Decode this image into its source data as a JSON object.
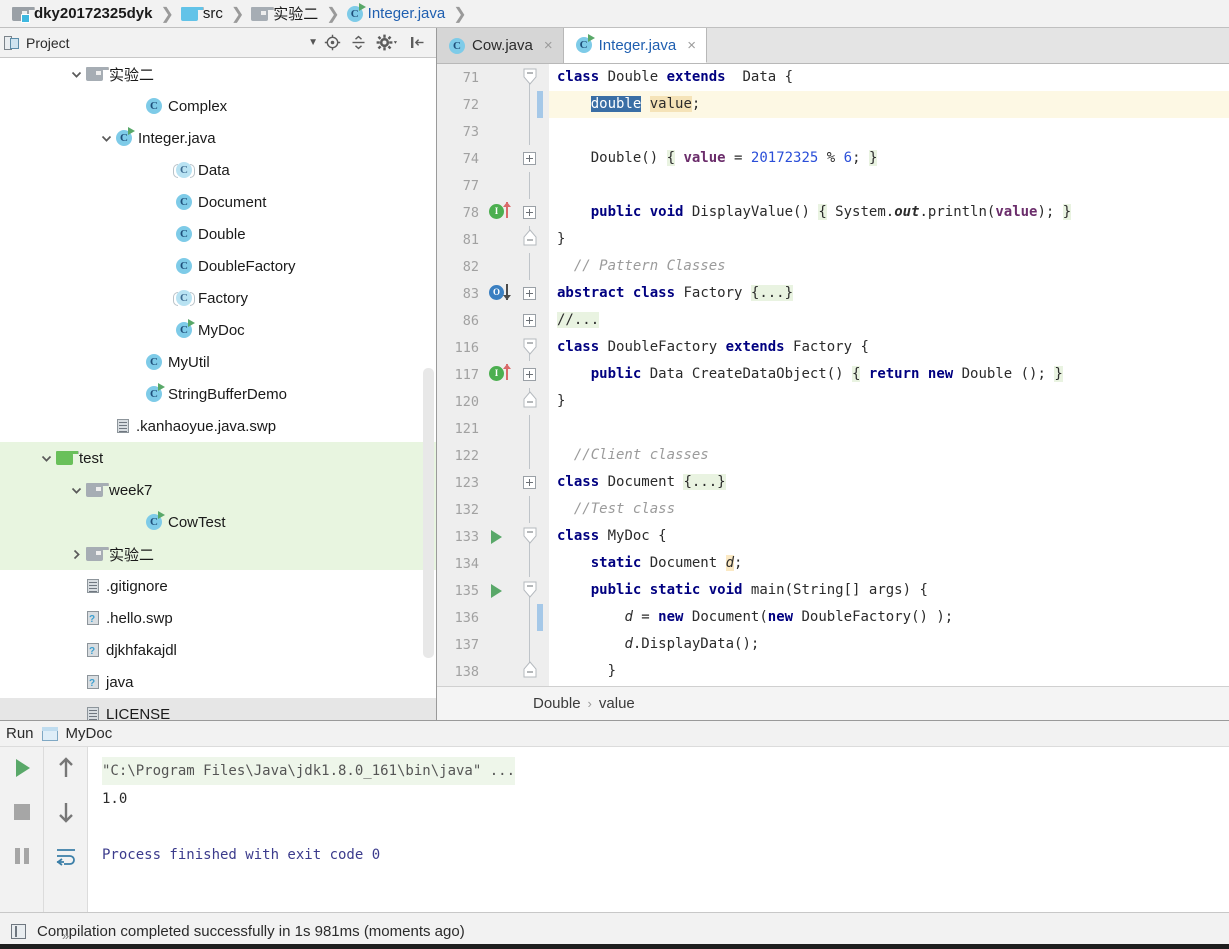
{
  "breadcrumb": [
    {
      "label": "dky20172325dyk",
      "icon": "folder-module-icon",
      "bold": true
    },
    {
      "label": "src",
      "icon": "folder-blue-icon",
      "bold": false
    },
    {
      "label": "实验二",
      "icon": "folder-gray-icon",
      "bold": false
    },
    {
      "label": "Integer.java",
      "icon": "java-class-run-icon",
      "bold": false,
      "active": true
    }
  ],
  "project_panel": {
    "title": "Project",
    "icons": {
      "project": "project-icon",
      "caret": "chevron-down-icon",
      "locate": "locate-target-icon",
      "collapse": "collapse-all-icon",
      "settings": "gear-icon",
      "hide": "hide-panel-icon"
    },
    "tree": [
      {
        "label": "实验二",
        "icon": "folder-gray-icon",
        "indent": 2,
        "twisty": "down",
        "state": "normal"
      },
      {
        "label": "Complex",
        "icon": "java-class-icon",
        "indent": 4,
        "twisty": "none",
        "state": "normal"
      },
      {
        "label": "Integer.java",
        "icon": "java-class-run-icon",
        "indent": 3,
        "twisty": "down",
        "state": "normal"
      },
      {
        "label": "Data",
        "icon": "java-abstract-class-icon",
        "indent": 5,
        "twisty": "none",
        "state": "normal"
      },
      {
        "label": "Document",
        "icon": "java-class-icon",
        "indent": 5,
        "twisty": "none",
        "state": "normal"
      },
      {
        "label": "Double",
        "icon": "java-class-icon",
        "indent": 5,
        "twisty": "none",
        "state": "normal"
      },
      {
        "label": "DoubleFactory",
        "icon": "java-class-icon",
        "indent": 5,
        "twisty": "none",
        "state": "normal"
      },
      {
        "label": "Factory",
        "icon": "java-abstract-class-icon",
        "indent": 5,
        "twisty": "none",
        "state": "normal"
      },
      {
        "label": "MyDoc",
        "icon": "java-class-run-icon",
        "indent": 5,
        "twisty": "none",
        "state": "normal"
      },
      {
        "label": "MyUtil",
        "icon": "java-class-icon",
        "indent": 4,
        "twisty": "none",
        "state": "normal"
      },
      {
        "label": "StringBufferDemo",
        "icon": "java-class-run-icon",
        "indent": 4,
        "twisty": "none",
        "state": "normal"
      },
      {
        "label": ".kanhaoyue.java.swp",
        "icon": "file-icon",
        "indent": 3,
        "twisty": "none",
        "state": "normal"
      },
      {
        "label": "test",
        "icon": "folder-green-icon",
        "indent": 1,
        "twisty": "down",
        "state": "selgreen"
      },
      {
        "label": "week7",
        "icon": "folder-gray-icon",
        "indent": 2,
        "twisty": "down",
        "state": "selgreen"
      },
      {
        "label": "CowTest",
        "icon": "java-class-run-icon",
        "indent": 4,
        "twisty": "none",
        "state": "selgreen"
      },
      {
        "label": "实验二",
        "icon": "folder-gray-icon",
        "indent": 2,
        "twisty": "right",
        "state": "selgreen"
      },
      {
        "label": ".gitignore",
        "icon": "file-icon",
        "indent": 2,
        "twisty": "none",
        "state": "normal"
      },
      {
        "label": ".hello.swp",
        "icon": "file-unknown-icon",
        "indent": 2,
        "twisty": "none",
        "state": "normal"
      },
      {
        "label": "djkhfakajdl",
        "icon": "file-unknown-icon",
        "indent": 2,
        "twisty": "none",
        "state": "normal"
      },
      {
        "label": "java",
        "icon": "file-unknown-icon",
        "indent": 2,
        "twisty": "none",
        "state": "normal"
      },
      {
        "label": "LICENSE",
        "icon": "file-icon",
        "indent": 2,
        "twisty": "none",
        "state": "selgray"
      }
    ]
  },
  "editor": {
    "tabs": [
      {
        "label": "Cow.java",
        "icon": "java-class-icon",
        "active": false,
        "close": "×"
      },
      {
        "label": "Integer.java",
        "icon": "java-class-run-icon",
        "active": true,
        "close": "×"
      }
    ],
    "breadcrumb": [
      "Double",
      "value"
    ],
    "breadcrumb_separator": "›",
    "lines": [
      {
        "num": "71",
        "gutter": "fold-top",
        "indent": 0
      },
      {
        "num": "72",
        "gutter": "changebar",
        "indent": 0,
        "caret": true
      },
      {
        "num": "73",
        "gutter": "",
        "indent": 0
      },
      {
        "num": "74",
        "gutter": "fold-plus",
        "indent": 0
      },
      {
        "num": "77",
        "gutter": "",
        "indent": 0
      },
      {
        "num": "78",
        "gutter": "fold-plus",
        "marker": "implements",
        "indent": 0
      },
      {
        "num": "81",
        "gutter": "fold-end",
        "indent": 0
      },
      {
        "num": "82",
        "gutter": "",
        "indent": 0
      },
      {
        "num": "83",
        "gutter": "fold-plus",
        "marker": "overridden",
        "indent": 0
      },
      {
        "num": "86",
        "gutter": "fold-plus",
        "indent": 0
      },
      {
        "num": "116",
        "gutter": "fold-top",
        "indent": 0
      },
      {
        "num": "117",
        "gutter": "fold-plus",
        "marker": "implements",
        "indent": 0
      },
      {
        "num": "120",
        "gutter": "fold-end",
        "indent": 0
      },
      {
        "num": "121",
        "gutter": "",
        "indent": 0
      },
      {
        "num": "122",
        "gutter": "",
        "indent": 0
      },
      {
        "num": "123",
        "gutter": "fold-plus",
        "indent": 0
      },
      {
        "num": "132",
        "gutter": "",
        "indent": 0
      },
      {
        "num": "133",
        "gutter": "fold-top",
        "marker": "run",
        "indent": 0
      },
      {
        "num": "134",
        "gutter": "",
        "indent": 0
      },
      {
        "num": "135",
        "gutter": "fold-top2",
        "marker": "run",
        "indent": 0
      },
      {
        "num": "136",
        "gutter": "changebar",
        "indent": 0
      },
      {
        "num": "137",
        "gutter": "",
        "indent": 0
      },
      {
        "num": "138",
        "gutter": "fold-end",
        "indent": 0
      }
    ],
    "code": {
      "l71": "class Double extends  Data {",
      "l72": "double value;",
      "l74": "Double() { value = 20172325 % 6; }",
      "l78": "public void DisplayValue() { System.out.println(value); }",
      "l81": "}",
      "l82": "// Pattern Classes",
      "l83": "abstract class Factory {...}",
      "l86": "//...",
      "l116": "class DoubleFactory extends Factory {",
      "l117": "public Data CreateDataObject() { return new Double (); }",
      "l120": "}",
      "l122": "//Client classes",
      "l123": "class Document {...}",
      "l132": "//Test class",
      "l133": "class MyDoc {",
      "l134": "static Document d;",
      "l135": "public static void main(String[] args) {",
      "l136": "d = new Document(new DoubleFactory() );",
      "l137": "d.DisplayData();",
      "l138": "}"
    }
  },
  "run_panel": {
    "title": "Run",
    "config_name": "MyDoc",
    "config_icon": "run-config-icon",
    "buttons": [
      "rerun-icon",
      "stop-icon",
      "pause-icon",
      "scroll-up-icon",
      "scroll-down-icon",
      "soft-wrap-icon"
    ],
    "expand_left": "»",
    "expand_right": "»",
    "console": [
      "\"C:\\Program Files\\Java\\jdk1.8.0_161\\bin\\java\" ...",
      "1.0",
      "",
      "Process finished with exit code 0"
    ]
  },
  "status_bar": {
    "icon": "build-icon",
    "message": "Compilation completed successfully in 1s 981ms (moments ago)"
  },
  "colors": {
    "keyword": "#000080",
    "number": "#2a4ed8",
    "comment": "#9b9b9b",
    "field": "#6b2d6b",
    "selection": "#3a6ea5",
    "caret_line": "#fdf8e4",
    "folded": "#e9f3e1",
    "tree_selection_green": "#e8f5e0",
    "accent_blue": "#1f5fb0",
    "run_green": "#59a869"
  }
}
